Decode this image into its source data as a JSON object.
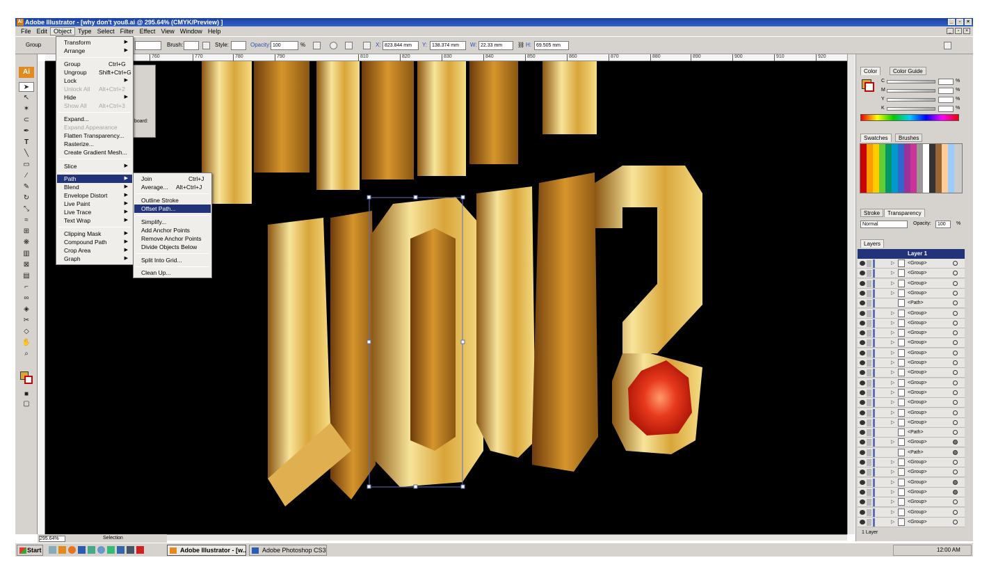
{
  "window": {
    "title": "Adobe Illustrator - [why don't you8.ai @ 295.64% (CMYK/Preview) ]"
  },
  "menubar": [
    "File",
    "Edit",
    "Object",
    "Type",
    "Select",
    "Filter",
    "Effect",
    "View",
    "Window",
    "Help"
  ],
  "control": {
    "selection": "Group",
    "brush_label": "Brush:",
    "style_label": "Style:",
    "opacity_label": "Opacity:",
    "opacity_value": "100",
    "pct": "%",
    "x_label": "X:",
    "x_value": "823.844 mm",
    "y_label": "Y:",
    "y_value": "138.374 mm",
    "w_label": "W:",
    "w_value": "22.33 mm",
    "h_label": "H:",
    "h_value": "69.505 mm"
  },
  "ruler_ticks": [
    "760",
    "770",
    "780",
    "790",
    "810",
    "820",
    "830",
    "840",
    "850",
    "860",
    "870",
    "880",
    "890",
    "900",
    "910",
    "920"
  ],
  "object_menu": [
    {
      "label": "Transform",
      "arrow": true
    },
    {
      "label": "Arrange",
      "arrow": true
    },
    {
      "sep": true
    },
    {
      "label": "Group",
      "shortcut": "Ctrl+G"
    },
    {
      "label": "Ungroup",
      "shortcut": "Shift+Ctrl+G"
    },
    {
      "label": "Lock",
      "arrow": true
    },
    {
      "label": "Unlock All",
      "shortcut": "Alt+Ctrl+2",
      "disabled": true
    },
    {
      "label": "Hide",
      "arrow": true
    },
    {
      "label": "Show All",
      "shortcut": "Alt+Ctrl+3",
      "disabled": true
    },
    {
      "sep": true
    },
    {
      "label": "Expand..."
    },
    {
      "label": "Expand Appearance",
      "disabled": true
    },
    {
      "label": "Flatten Transparency..."
    },
    {
      "label": "Rasterize..."
    },
    {
      "label": "Create Gradient Mesh..."
    },
    {
      "sep": true
    },
    {
      "label": "Slice",
      "arrow": true
    },
    {
      "sep": true
    },
    {
      "label": "Path",
      "arrow": true,
      "highlight": true
    },
    {
      "label": "Blend",
      "arrow": true
    },
    {
      "label": "Envelope Distort",
      "arrow": true
    },
    {
      "label": "Live Paint",
      "arrow": true
    },
    {
      "label": "Live Trace",
      "arrow": true
    },
    {
      "label": "Text Wrap",
      "arrow": true
    },
    {
      "sep": true
    },
    {
      "label": "Clipping Mask",
      "arrow": true
    },
    {
      "label": "Compound Path",
      "arrow": true
    },
    {
      "label": "Crop Area",
      "arrow": true
    },
    {
      "label": "Graph",
      "arrow": true
    }
  ],
  "path_menu": [
    {
      "label": "Join",
      "shortcut": "Ctrl+J"
    },
    {
      "label": "Average...",
      "shortcut": "Alt+Ctrl+J"
    },
    {
      "sep": true
    },
    {
      "label": "Outline Stroke"
    },
    {
      "label": "Offset Path...",
      "highlight": true
    },
    {
      "sep": true
    },
    {
      "label": "Simplify..."
    },
    {
      "label": "Add Anchor Points"
    },
    {
      "label": "Remove Anchor Points"
    },
    {
      "label": "Divide Objects Below"
    },
    {
      "sep": true
    },
    {
      "label": "Split Into Grid..."
    },
    {
      "sep": true
    },
    {
      "label": "Clean Up..."
    }
  ],
  "float_panel": {
    "artboard_label": "board:"
  },
  "color_panel": {
    "tabs": [
      "Color",
      "Color Guide"
    ],
    "channels": [
      "C",
      "M",
      "Y",
      "K"
    ],
    "pct": "%"
  },
  "swatches_panel": {
    "tabs": [
      "Swatches",
      "Brushes"
    ]
  },
  "transparency_panel": {
    "tabs": [
      "Stroke",
      "Transparency"
    ],
    "mode": "Normal",
    "opacity_label": "Opacity:",
    "opacity_value": "100",
    "pct": "%"
  },
  "layers_panel": {
    "tab": "Layers",
    "layer_name": "Layer 1",
    "rows": [
      {
        "name": "<Group>",
        "tri": true,
        "fill": false
      },
      {
        "name": "<Group>",
        "tri": true,
        "fill": false
      },
      {
        "name": "<Group>",
        "tri": true,
        "fill": false
      },
      {
        "name": "<Group>",
        "tri": true,
        "fill": false
      },
      {
        "name": "<Path>",
        "tri": false,
        "fill": false
      },
      {
        "name": "<Group>",
        "tri": true,
        "fill": false
      },
      {
        "name": "<Group>",
        "tri": true,
        "fill": false
      },
      {
        "name": "<Group>",
        "tri": true,
        "fill": false
      },
      {
        "name": "<Group>",
        "tri": true,
        "fill": false
      },
      {
        "name": "<Group>",
        "tri": true,
        "fill": false
      },
      {
        "name": "<Group>",
        "tri": true,
        "fill": false
      },
      {
        "name": "<Group>",
        "tri": true,
        "fill": false
      },
      {
        "name": "<Group>",
        "tri": true,
        "fill": false
      },
      {
        "name": "<Group>",
        "tri": true,
        "fill": false
      },
      {
        "name": "<Group>",
        "tri": true,
        "fill": false
      },
      {
        "name": "<Group>",
        "tri": true,
        "fill": false
      },
      {
        "name": "<Group>",
        "tri": true,
        "fill": false
      },
      {
        "name": "<Path>",
        "tri": false,
        "fill": false
      },
      {
        "name": "<Group>",
        "tri": true,
        "fill": true
      },
      {
        "name": "<Path>",
        "tri": false,
        "fill": true
      },
      {
        "name": "<Group>",
        "tri": true,
        "fill": false
      },
      {
        "name": "<Group>",
        "tri": true,
        "fill": false
      },
      {
        "name": "<Group>",
        "tri": true,
        "fill": true
      },
      {
        "name": "<Group>",
        "tri": true,
        "fill": true
      },
      {
        "name": "<Group>",
        "tri": true,
        "fill": false
      },
      {
        "name": "<Group>",
        "tri": true,
        "fill": false
      },
      {
        "name": "<Group>",
        "tri": true,
        "fill": false
      }
    ],
    "footer": "1 Layer"
  },
  "status": {
    "zoom": "295.64%",
    "tool": "Selection"
  },
  "taskbar": {
    "start": "Start",
    "tasks": [
      "Adobe Illustrator - [w...",
      "Adobe Photoshop CS3"
    ],
    "clock": "12:00 AM"
  },
  "colors": {
    "gold_light": "#f7e49a",
    "gold_mid": "#d9a53a",
    "gold_dark": "#8a5612",
    "ruby": "#e8391c",
    "select": "#5b6fb8",
    "menu_hl": "#22337a"
  }
}
